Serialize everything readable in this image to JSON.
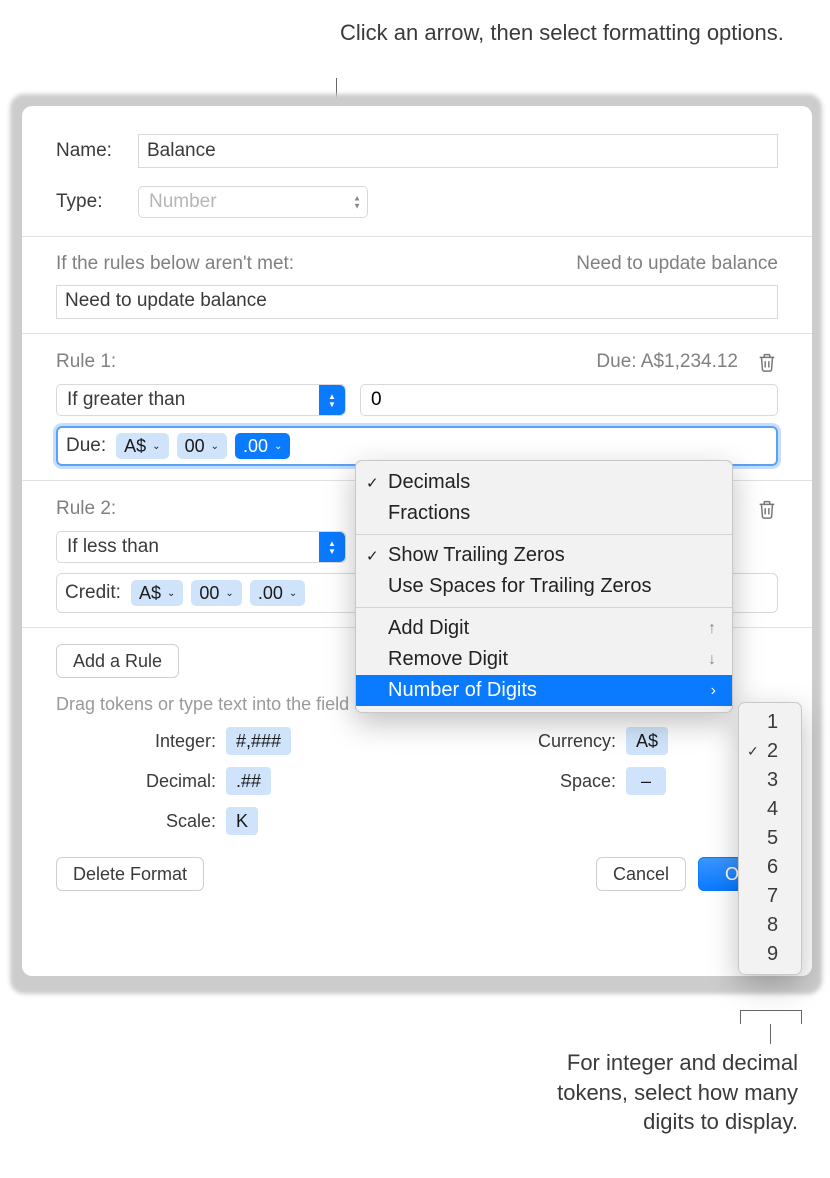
{
  "callouts": {
    "top": "Click an arrow, then select formatting options.",
    "bottom": "For integer and decimal tokens, select how many digits to display."
  },
  "fields": {
    "name_label": "Name:",
    "name_value": "Balance",
    "type_label": "Type:",
    "type_value": "Number"
  },
  "fallback": {
    "label": "If the rules below aren't met:",
    "preview": "Need to update balance",
    "value": "Need to update balance"
  },
  "rule1": {
    "label": "Rule 1:",
    "preview": "Due: A$1,234.12",
    "condition": "If greater than",
    "value": "0",
    "format_prefix": "Due:",
    "tokens": {
      "currency": "A$",
      "integer": "00",
      "decimal": ".00"
    }
  },
  "rule2": {
    "label": "Rule 2:",
    "condition": "If less than",
    "format_prefix": "Credit:",
    "tokens": {
      "currency": "A$",
      "integer": "00",
      "decimal": ".00"
    }
  },
  "buttons": {
    "add_rule": "Add a Rule",
    "delete_format": "Delete Format",
    "cancel": "Cancel",
    "ok": "OK"
  },
  "hint": "Drag tokens or type text into the field above:",
  "token_samples": {
    "integer_label": "Integer:",
    "integer_value": "#,###",
    "decimal_label": "Decimal:",
    "decimal_value": ".##",
    "scale_label": "Scale:",
    "scale_value": "K",
    "currency_label": "Currency:",
    "currency_value": "A$",
    "space_label": "Space:",
    "space_value": "–"
  },
  "menu": {
    "decimals": "Decimals",
    "fractions": "Fractions",
    "show_trailing": "Show Trailing Zeros",
    "use_spaces": "Use Spaces for Trailing Zeros",
    "add_digit": "Add Digit",
    "remove_digit": "Remove Digit",
    "num_digits": "Number of Digits"
  },
  "submenu": {
    "options": [
      "1",
      "2",
      "3",
      "4",
      "5",
      "6",
      "7",
      "8",
      "9"
    ],
    "selected": "2"
  }
}
